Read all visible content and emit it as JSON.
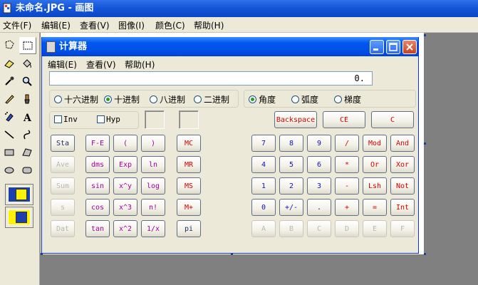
{
  "paint": {
    "title": "未命名.JPG - 画图",
    "menu": [
      "文件(F)",
      "编辑(E)",
      "查看(V)",
      "图像(I)",
      "颜色(C)",
      "帮助(H)"
    ],
    "tools": [
      "free-select-icon",
      "rect-select-icon",
      "eraser-icon",
      "fill-icon",
      "eyedropper-icon",
      "magnifier-icon",
      "pencil-icon",
      "brush-icon",
      "airbrush-icon",
      "text-icon",
      "line-icon",
      "curve-icon",
      "rectangle-icon",
      "polygon-icon",
      "ellipse-icon",
      "rounded-rect-icon"
    ]
  },
  "calculator": {
    "title": "计算器",
    "menu": [
      "编辑(E)",
      "查看(V)",
      "帮助(H)"
    ],
    "display": "0.",
    "base_options": [
      "十六进制",
      "十进制",
      "八进制",
      "二进制"
    ],
    "base_selected": "十进制",
    "angle_options": [
      "角度",
      "弧度",
      "梯度"
    ],
    "angle_selected": "角度",
    "checks": [
      "Inv",
      "Hyp"
    ],
    "top_keys": [
      "Backspace",
      "CE",
      "C"
    ],
    "col1": [
      "Sta",
      "Ave",
      "Sum",
      "s",
      "Dat"
    ],
    "sci_keys": [
      [
        "F-E",
        "(",
        ")"
      ],
      [
        "dms",
        "Exp",
        "ln"
      ],
      [
        "sin",
        "x^y",
        "log"
      ],
      [
        "cos",
        "x^3",
        "n!"
      ],
      [
        "tan",
        "x^2",
        "1/x"
      ]
    ],
    "memory_keys": [
      "MC",
      "MR",
      "MS",
      "M+",
      "pi"
    ],
    "num_keys": [
      [
        "7",
        "8",
        "9",
        "/",
        "Mod",
        "And"
      ],
      [
        "4",
        "5",
        "6",
        "*",
        "Or",
        "Xor"
      ],
      [
        "1",
        "2",
        "3",
        "-",
        "Lsh",
        "Not"
      ],
      [
        "0",
        "+/-",
        ".",
        "+",
        "=",
        "Int"
      ],
      [
        "A",
        "B",
        "C",
        "D",
        "E",
        "F"
      ]
    ]
  }
}
